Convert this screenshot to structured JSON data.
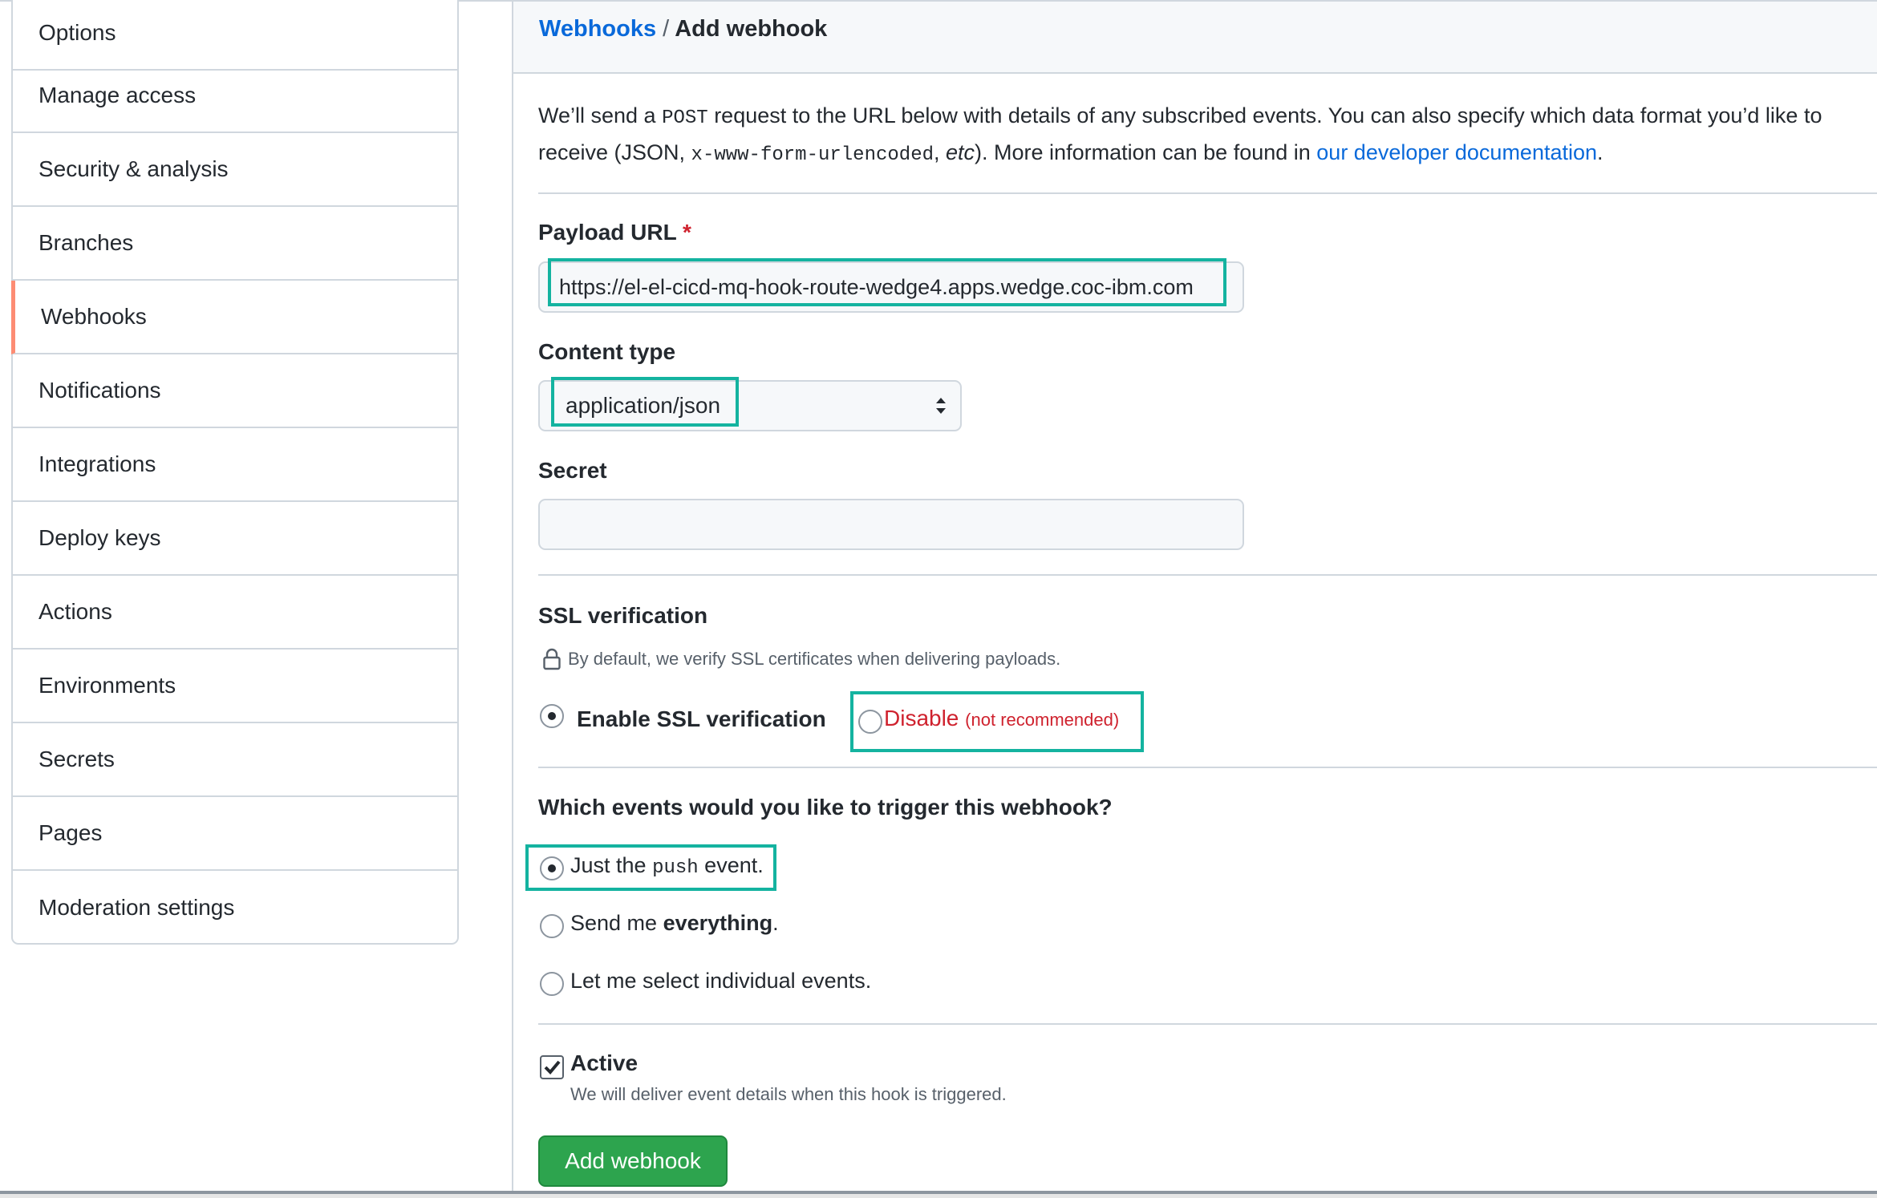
{
  "sidebar": {
    "items": [
      {
        "label": "Options"
      },
      {
        "label": "Manage access"
      },
      {
        "label": "Security & analysis"
      },
      {
        "label": "Branches"
      },
      {
        "label": "Webhooks",
        "active": true
      },
      {
        "label": "Notifications"
      },
      {
        "label": "Integrations"
      },
      {
        "label": "Deploy keys"
      },
      {
        "label": "Actions"
      },
      {
        "label": "Environments"
      },
      {
        "label": "Secrets"
      },
      {
        "label": "Pages"
      },
      {
        "label": "Moderation settings"
      }
    ]
  },
  "breadcrumb": {
    "parent": "Webhooks",
    "separator": "/",
    "current": "Add webhook"
  },
  "intro": {
    "part1": "We’ll send a ",
    "code1": "POST",
    "part2": " request to the URL below with details of any subscribed events. You can also specify which data format you’d like to receive (JSON, ",
    "code2": "x-www-form-urlencoded",
    "part3": ", ",
    "etc": "etc",
    "part4": "). More information can be found in ",
    "link": "our developer documentation",
    "part5": "."
  },
  "payload": {
    "label": "Payload URL",
    "required_mark": "*",
    "value": "https://el-el-cicd-mq-hook-route-wedge4.apps.wedge.coc-ibm.com"
  },
  "content_type": {
    "label": "Content type",
    "value": "application/json"
  },
  "secret": {
    "label": "Secret",
    "value": ""
  },
  "ssl": {
    "title": "SSL verification",
    "note": "By default, we verify SSL certificates when delivering payloads.",
    "enable_label": "Enable SSL verification",
    "disable_label": "Disable",
    "disable_note": "(not recommended)",
    "selected": "enable"
  },
  "events": {
    "question": "Which events would you like to trigger this webhook?",
    "opt1_pre": "Just the ",
    "opt1_code": "push",
    "opt1_post": " event.",
    "opt2_pre": "Send me ",
    "opt2_bold": "everything",
    "opt2_post": ".",
    "opt3": "Let me select individual events.",
    "selected": "push"
  },
  "active": {
    "label": "Active",
    "note": "We will deliver event details when this hook is triggered.",
    "checked": true
  },
  "submit_label": "Add webhook",
  "colors": {
    "link": "#0969da",
    "danger": "#cf222e",
    "primary_button": "#2da44e",
    "highlight": "#14b3a0",
    "active_marker": "#fd8c73"
  }
}
